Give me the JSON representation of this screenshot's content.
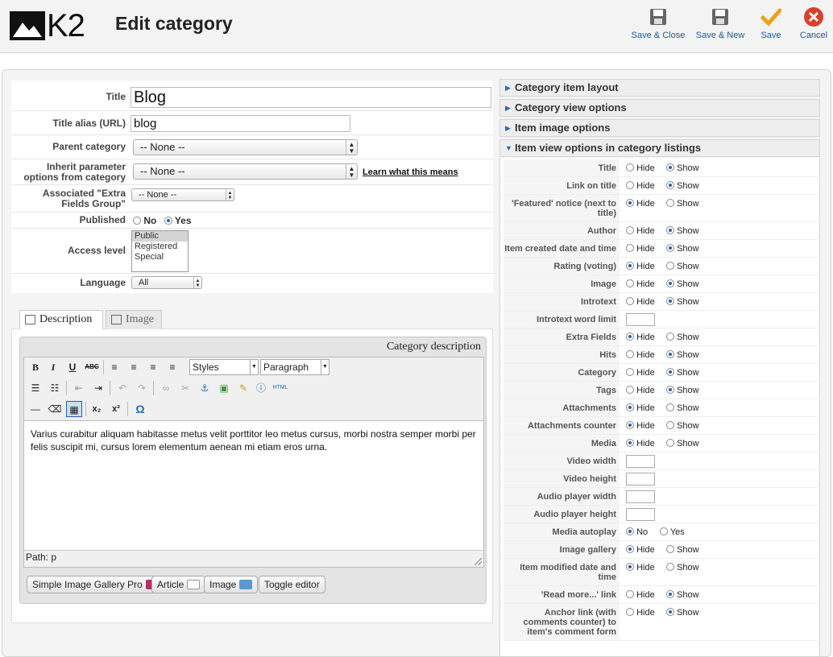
{
  "header": {
    "logo_text": "K2",
    "page_title": "Edit category",
    "toolbar": {
      "save_close": "Save & Close",
      "save_new": "Save & New",
      "save": "Save",
      "cancel": "Cancel"
    }
  },
  "form": {
    "title_label": "Title",
    "title_value": "Blog",
    "alias_label": "Title alias (URL)",
    "alias_value": "blog",
    "parent_label": "Parent category",
    "parent_value": "-- None --",
    "inherit_label": "Inherit parameter options from category",
    "inherit_value": "-- None --",
    "learn_link": "Learn what this means",
    "extra_label": "Associated \"Extra Fields Group\"",
    "extra_value": "-- None --",
    "published_label": "Published",
    "published_no": "No",
    "published_yes": "Yes",
    "access_label": "Access level",
    "access_options": [
      "Public",
      "Registered",
      "Special"
    ],
    "language_label": "Language",
    "language_value": "All"
  },
  "tabs": {
    "description": "Description",
    "image": "Image"
  },
  "editor": {
    "caption": "Category description",
    "styles": "Styles",
    "format": "Paragraph",
    "body_text": "Varius curabitur aliquam habitasse metus velit porttitor leo metus cursus, morbi nostra semper morbi per felis suscipit mi, cursus lorem elementum aenean mi etiam eros urna.",
    "path": "Path: p",
    "buttons": {
      "gallery": "Simple Image Gallery Pro",
      "article": "Article",
      "image": "Image",
      "toggle": "Toggle editor"
    }
  },
  "accordion": {
    "item_layout": "Category item layout",
    "view_options": "Category view options",
    "image_options": "Item image options",
    "listing_options": "Item view options in category listings"
  },
  "options": {
    "hide": "Hide",
    "show": "Show",
    "no": "No",
    "yes": "Yes",
    "rows": [
      {
        "label": "Title",
        "selected": "show"
      },
      {
        "label": "Link on title",
        "selected": "show"
      },
      {
        "label": "'Featured' notice (next to title)",
        "selected": "hide"
      },
      {
        "label": "Author",
        "selected": "show"
      },
      {
        "label": "Item created date and time",
        "selected": "show"
      },
      {
        "label": "Rating (voting)",
        "selected": "hide"
      },
      {
        "label": "Image",
        "selected": "show"
      },
      {
        "label": "Introtext",
        "selected": "show"
      },
      {
        "label": "Introtext word limit",
        "selected": "input"
      },
      {
        "label": "Extra Fields",
        "selected": "hide"
      },
      {
        "label": "Hits",
        "selected": "show"
      },
      {
        "label": "Category",
        "selected": "show"
      },
      {
        "label": "Tags",
        "selected": "show"
      },
      {
        "label": "Attachments",
        "selected": "hide"
      },
      {
        "label": "Attachments counter",
        "selected": "hide"
      },
      {
        "label": "Media",
        "selected": "hide"
      },
      {
        "label": "Video width",
        "selected": "input"
      },
      {
        "label": "Video height",
        "selected": "input"
      },
      {
        "label": "Audio player width",
        "selected": "input"
      },
      {
        "label": "Audio player height",
        "selected": "input"
      },
      {
        "label": "Media autoplay",
        "selected": "no"
      },
      {
        "label": "Image gallery",
        "selected": "hide"
      },
      {
        "label": "Item modified date and time",
        "selected": "hide"
      },
      {
        "label": "'Read more...' link",
        "selected": "show"
      },
      {
        "label": "Anchor link (with comments counter) to item's comment form",
        "selected": "show"
      }
    ]
  },
  "colors": {
    "link_blue": "#1a5a96",
    "save_orange": "#f0a020",
    "cancel_red": "#d8402a"
  }
}
